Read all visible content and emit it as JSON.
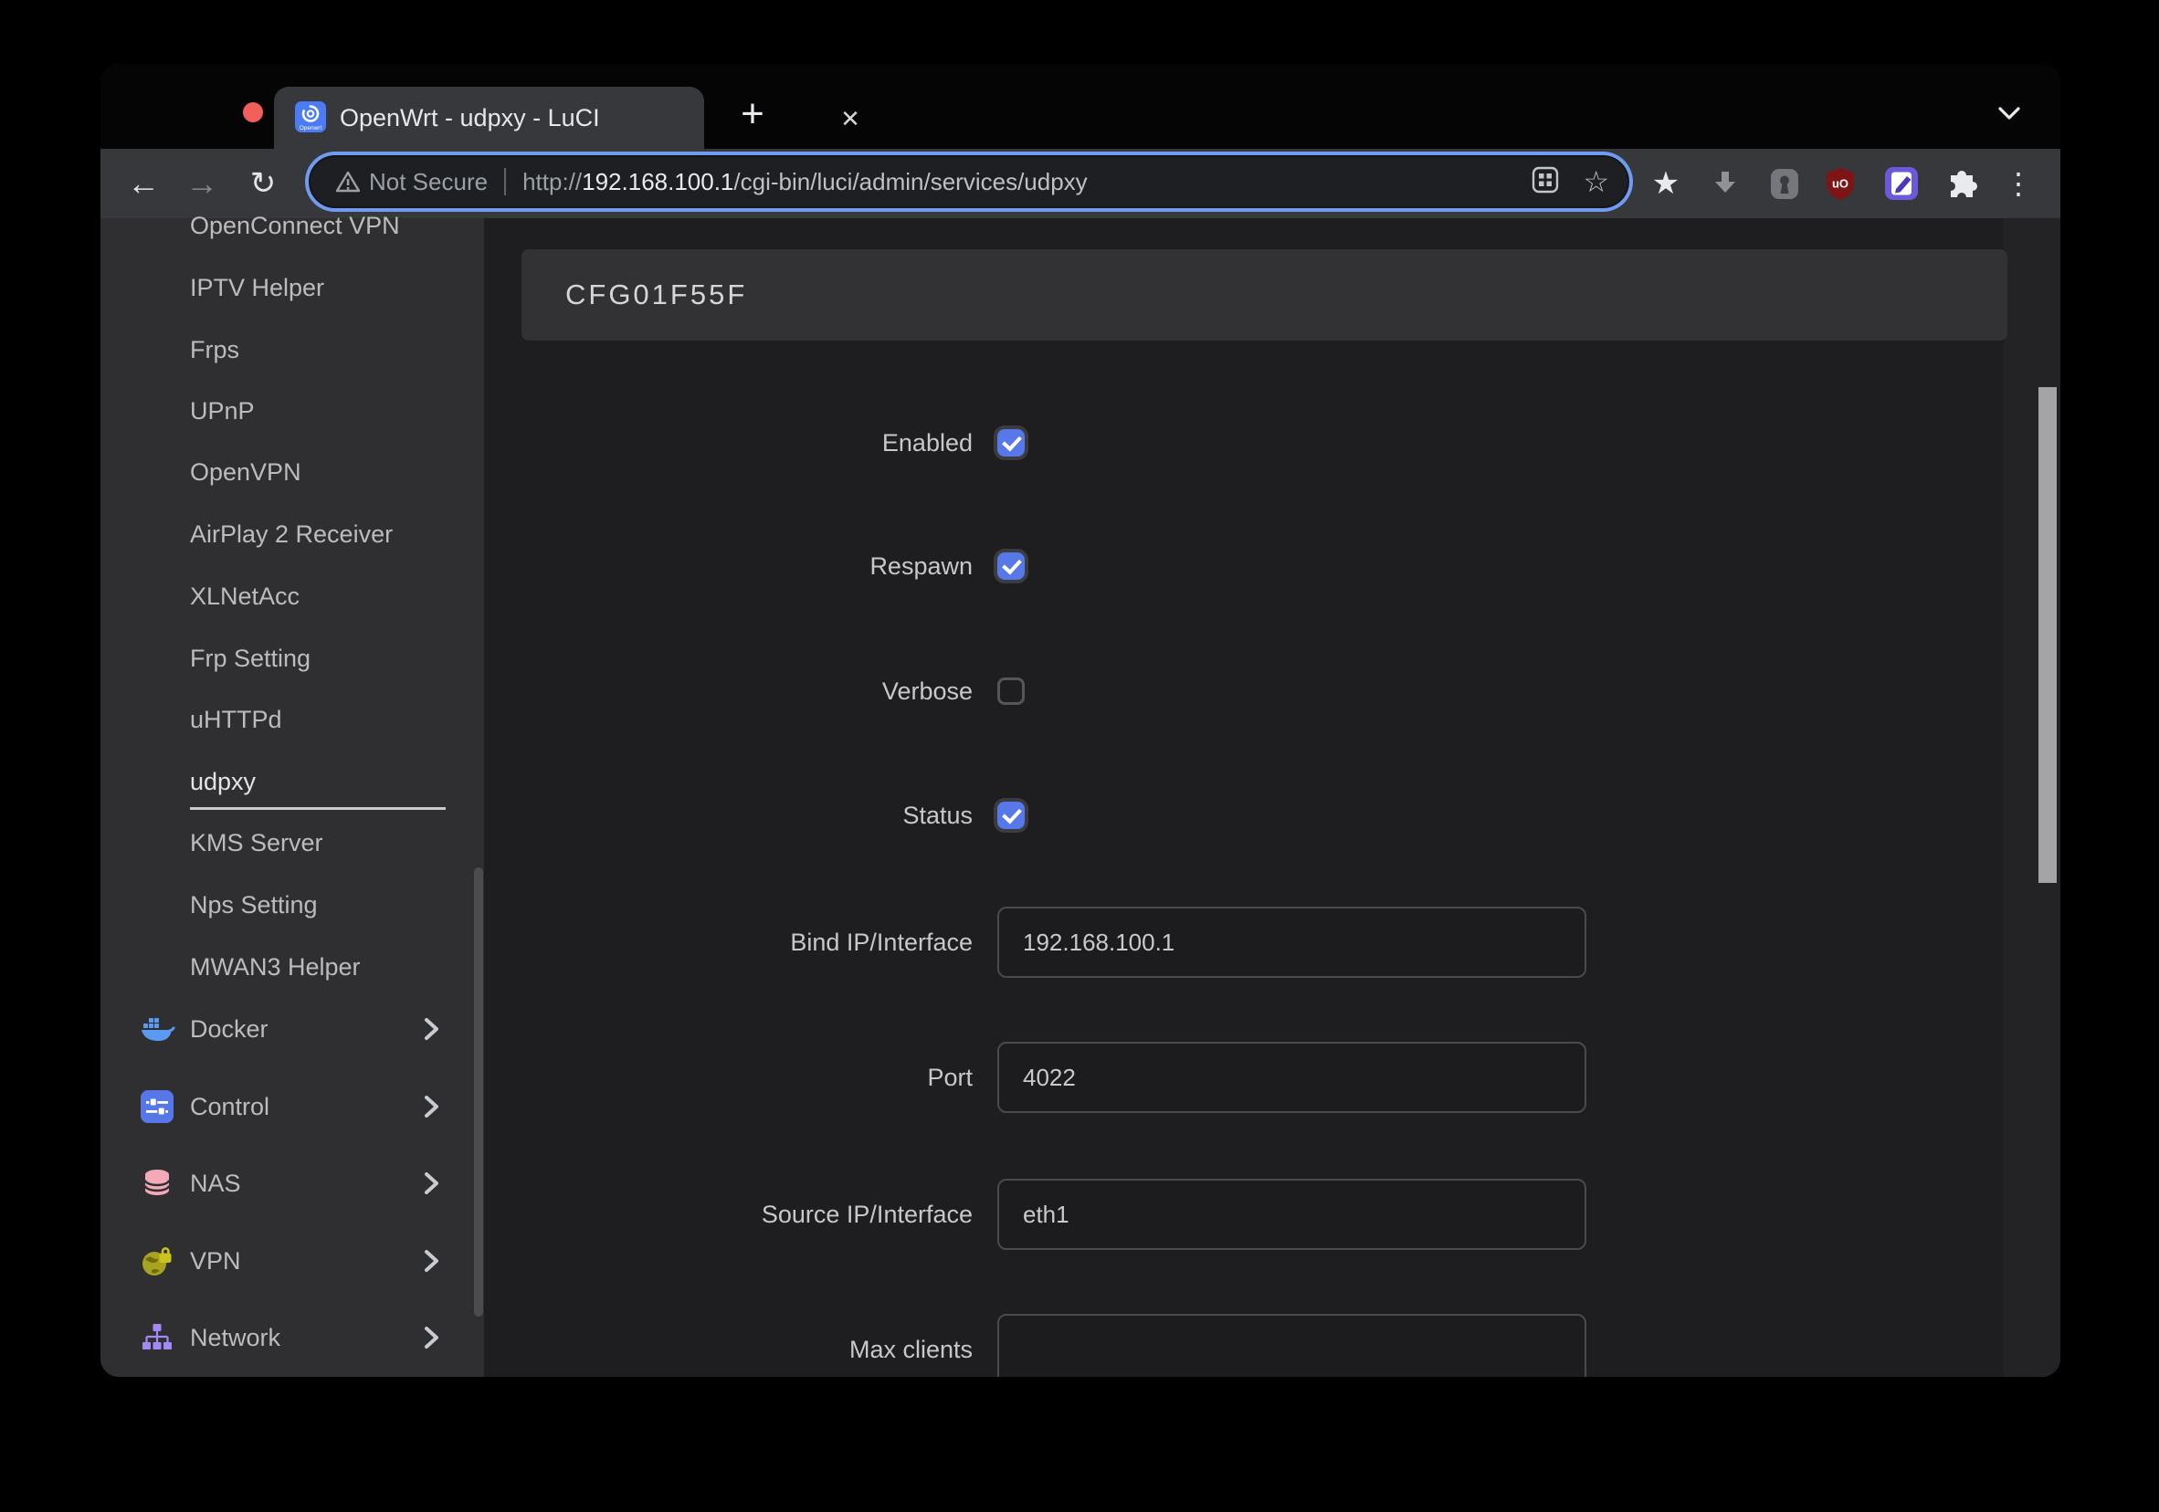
{
  "browser": {
    "tab": {
      "title": "OpenWrt - udpxy - LuCI",
      "favicon": "openwrt-logo",
      "close_label": "✕",
      "new_tab_label": "+"
    },
    "nav": {
      "back_glyph": "←",
      "forward_glyph": "→",
      "reload_glyph": "↻"
    },
    "url": {
      "security_label": "Not Secure",
      "scheme": "http://",
      "host": "192.168.100.1",
      "path": "/cgi-bin/luci/admin/services/udpxy"
    },
    "toolbar_icons": [
      "bookmark-star-icon",
      "download-arrow-icon",
      "password-keyhole-icon",
      "ublock-shield-icon",
      "edit-extension-icon",
      "puzzle-extensions-icon",
      "menu-dots-icon"
    ],
    "menu_dots_glyph": "⋮",
    "star_filled_glyph": "★",
    "star_outline_glyph": "☆"
  },
  "sidebar": {
    "items": [
      {
        "label": "OpenConnect VPN"
      },
      {
        "label": "IPTV Helper"
      },
      {
        "label": "Frps"
      },
      {
        "label": "UPnP"
      },
      {
        "label": "OpenVPN"
      },
      {
        "label": "AirPlay 2 Receiver"
      },
      {
        "label": "XLNetAcc"
      },
      {
        "label": "Frp Setting"
      },
      {
        "label": "uHTTPd"
      },
      {
        "label": "udpxy",
        "active": true
      },
      {
        "label": "KMS Server"
      },
      {
        "label": "Nps Setting"
      },
      {
        "label": "MWAN3 Helper"
      },
      {
        "label": "Docker",
        "icon": "docker-icon",
        "expandable": true
      },
      {
        "label": "Control",
        "icon": "control-icon",
        "expandable": true
      },
      {
        "label": "NAS",
        "icon": "nas-icon",
        "expandable": true
      },
      {
        "label": "VPN",
        "icon": "vpn-icon",
        "expandable": true
      },
      {
        "label": "Network",
        "icon": "network-icon",
        "expandable": true
      }
    ]
  },
  "main": {
    "section_title": "CFG01F55F",
    "fields": [
      {
        "label": "Enabled",
        "type": "checkbox",
        "checked": true
      },
      {
        "label": "Respawn",
        "type": "checkbox",
        "checked": true
      },
      {
        "label": "Verbose",
        "type": "checkbox",
        "checked": false
      },
      {
        "label": "Status",
        "type": "checkbox",
        "checked": true
      },
      {
        "label": "Bind IP/Interface",
        "type": "text",
        "value": "192.168.100.1"
      },
      {
        "label": "Port",
        "type": "text",
        "value": "4022"
      },
      {
        "label": "Source IP/Interface",
        "type": "text",
        "value": "eth1"
      },
      {
        "label": "Max clients",
        "type": "text",
        "value": ""
      }
    ]
  },
  "colors": {
    "accent_blue_checkbox": "#5678e8",
    "focus_ring_blue": "#6f9cf0",
    "toolbar_bg": "#37383b",
    "sidebar_bg": "#2f2f32",
    "main_bg": "#1e1e20",
    "panel_bg": "#323235",
    "docker_blue": "#5b9af2",
    "control_blue": "#5777e8",
    "nas_pink": "#f4a9b8",
    "vpn_olive": "#a9a41d",
    "network_purple": "#a289f2",
    "ublock_red": "#7f1417",
    "traffic_red": "#f25e5a",
    "traffic_yellow": "#f7bd45",
    "traffic_green": "#38c74b"
  }
}
